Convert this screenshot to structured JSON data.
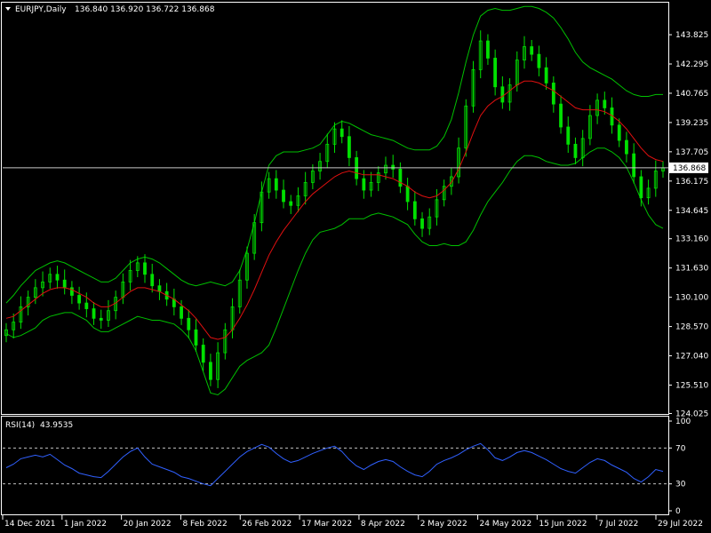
{
  "header": {
    "symbol": "EURJPY,Daily",
    "ohlc": "136.840 136.920 136.722 136.868"
  },
  "colors": {
    "background": "#000000",
    "bull_candle": "#00e000",
    "ma": "#e01010",
    "bands": "#00c000",
    "rsi": "#3060ff",
    "axis": "#ffffff",
    "price_line": "#c8c8c8"
  },
  "chart_data": [
    {
      "type": "candlestick",
      "title": "EURJPY,Daily",
      "ohlc_readout": "136.840 136.920 136.722 136.868",
      "price_ticks": [
        "143.825",
        "142.295",
        "140.765",
        "139.235",
        "137.705",
        "136.175",
        "134.645",
        "133.160",
        "131.630",
        "130.100",
        "128.570",
        "127.040",
        "125.510",
        "124.025"
      ],
      "x_ticks": [
        "14 Dec 2021",
        "1 Jan 2022",
        "20 Jan 2022",
        "8 Feb 2022",
        "26 Feb 2022",
        "17 Mar 2022",
        "8 Apr 2022",
        "2 May 2022",
        "24 May 2022",
        "15 Jun 2022",
        "7 Jul 2022",
        "29 Jul 2022"
      ],
      "ylim": [
        124.0,
        145.5
      ],
      "current_price": 136.868,
      "close": [
        128.4,
        128.8,
        129.6,
        130.1,
        130.6,
        130.9,
        131.3,
        131.0,
        130.6,
        130.2,
        129.8,
        129.5,
        129.0,
        128.9,
        129.4,
        130.1,
        130.9,
        131.5,
        131.9,
        131.3,
        130.7,
        130.4,
        130.0,
        129.6,
        129.0,
        128.4,
        127.6,
        126.7,
        125.8,
        127.2,
        128.4,
        129.6,
        131.0,
        132.4,
        134.0,
        135.6,
        136.3,
        135.7,
        135.1,
        134.9,
        135.4,
        136.1,
        136.7,
        137.2,
        138.1,
        138.9,
        138.5,
        137.4,
        136.3,
        135.7,
        136.1,
        136.6,
        137.0,
        136.8,
        135.9,
        135.1,
        134.2,
        133.7,
        134.3,
        135.2,
        135.9,
        136.4,
        137.9,
        140.1,
        142.0,
        143.5,
        142.6,
        141.1,
        140.3,
        141.2,
        142.5,
        143.2,
        142.8,
        142.1,
        141.3,
        140.2,
        139.0,
        138.1,
        137.4,
        138.4,
        139.6,
        140.4,
        140.0,
        139.1,
        138.3,
        137.6,
        136.4,
        135.3,
        135.8,
        136.7,
        136.868
      ],
      "ma": [
        129.0,
        129.1,
        129.4,
        129.7,
        130.0,
        130.3,
        130.5,
        130.6,
        130.6,
        130.5,
        130.3,
        130.1,
        129.8,
        129.6,
        129.6,
        129.8,
        130.1,
        130.4,
        130.6,
        130.6,
        130.5,
        130.4,
        130.2,
        130.0,
        129.7,
        129.4,
        129.0,
        128.5,
        128.0,
        127.9,
        128.0,
        128.4,
        129.0,
        129.7,
        130.5,
        131.4,
        132.3,
        133.0,
        133.6,
        134.1,
        134.6,
        135.1,
        135.5,
        135.8,
        136.1,
        136.4,
        136.6,
        136.7,
        136.6,
        136.5,
        136.5,
        136.5,
        136.4,
        136.3,
        136.1,
        135.9,
        135.6,
        135.4,
        135.3,
        135.4,
        135.7,
        136.1,
        136.8,
        137.7,
        138.7,
        139.6,
        140.1,
        140.4,
        140.6,
        140.9,
        141.2,
        141.4,
        141.4,
        141.3,
        141.1,
        140.9,
        140.6,
        140.3,
        140.0,
        139.9,
        139.9,
        139.9,
        139.8,
        139.6,
        139.3,
        138.9,
        138.4,
        137.9,
        137.5,
        137.3,
        137.2
      ],
      "bb_upper": [
        129.8,
        130.2,
        130.7,
        131.1,
        131.5,
        131.7,
        131.9,
        132.0,
        131.9,
        131.7,
        131.5,
        131.3,
        131.1,
        130.9,
        130.9,
        131.1,
        131.5,
        131.9,
        132.1,
        132.2,
        132.1,
        131.9,
        131.6,
        131.3,
        131.0,
        130.8,
        130.7,
        130.8,
        130.9,
        130.8,
        130.7,
        130.9,
        131.5,
        132.6,
        134.0,
        135.6,
        137.0,
        137.5,
        137.7,
        137.7,
        137.7,
        137.8,
        137.9,
        138.1,
        138.6,
        139.1,
        139.3,
        139.2,
        139.0,
        138.8,
        138.6,
        138.5,
        138.4,
        138.3,
        138.1,
        137.9,
        137.8,
        137.8,
        137.8,
        138.0,
        138.5,
        139.4,
        140.8,
        142.4,
        143.8,
        144.8,
        145.1,
        145.2,
        145.1,
        145.1,
        145.2,
        145.3,
        145.3,
        145.2,
        145.0,
        144.7,
        144.2,
        143.6,
        142.9,
        142.4,
        142.1,
        141.9,
        141.7,
        141.5,
        141.2,
        140.9,
        140.7,
        140.6,
        140.6,
        140.7,
        140.7
      ],
      "bb_lower": [
        128.2,
        128.0,
        128.1,
        128.3,
        128.5,
        128.9,
        129.1,
        129.2,
        129.3,
        129.3,
        129.1,
        128.9,
        128.5,
        128.3,
        128.3,
        128.5,
        128.7,
        128.9,
        129.1,
        129.0,
        128.9,
        128.9,
        128.8,
        128.7,
        128.4,
        128.0,
        127.3,
        126.2,
        125.1,
        125.0,
        125.3,
        125.9,
        126.5,
        126.8,
        127.0,
        127.2,
        127.6,
        128.5,
        129.5,
        130.5,
        131.5,
        132.4,
        133.1,
        133.5,
        133.6,
        133.7,
        133.9,
        134.2,
        134.2,
        134.2,
        134.4,
        134.5,
        134.4,
        134.3,
        134.1,
        133.9,
        133.4,
        133.0,
        132.8,
        132.8,
        132.9,
        132.8,
        132.8,
        133.0,
        133.6,
        134.4,
        135.1,
        135.6,
        136.1,
        136.7,
        137.2,
        137.5,
        137.5,
        137.4,
        137.2,
        137.1,
        137.0,
        137.0,
        137.1,
        137.4,
        137.7,
        137.9,
        137.9,
        137.7,
        137.4,
        136.9,
        136.1,
        135.2,
        134.4,
        133.9,
        133.7
      ]
    },
    {
      "type": "line",
      "title": "RSI(14) 43.9535",
      "name": "RSI(14)",
      "readout": "43.9535",
      "ylim": [
        0,
        100
      ],
      "y_ticks": [
        "100",
        "70",
        "30",
        "0"
      ],
      "levels": [
        70,
        30
      ],
      "values": [
        48,
        52,
        58,
        60,
        62,
        60,
        63,
        57,
        51,
        47,
        42,
        40,
        38,
        37,
        44,
        52,
        60,
        66,
        70,
        60,
        52,
        49,
        46,
        43,
        38,
        36,
        33,
        30,
        28,
        36,
        44,
        52,
        60,
        66,
        70,
        74,
        71,
        64,
        58,
        54,
        56,
        60,
        64,
        67,
        70,
        72,
        66,
        57,
        50,
        46,
        51,
        55,
        57,
        55,
        49,
        44,
        40,
        38,
        44,
        52,
        56,
        59,
        63,
        68,
        72,
        75,
        68,
        59,
        56,
        60,
        65,
        67,
        65,
        61,
        57,
        52,
        47,
        44,
        42,
        48,
        54,
        58,
        56,
        51,
        47,
        43,
        36,
        32,
        38,
        46,
        43.9535
      ]
    }
  ]
}
